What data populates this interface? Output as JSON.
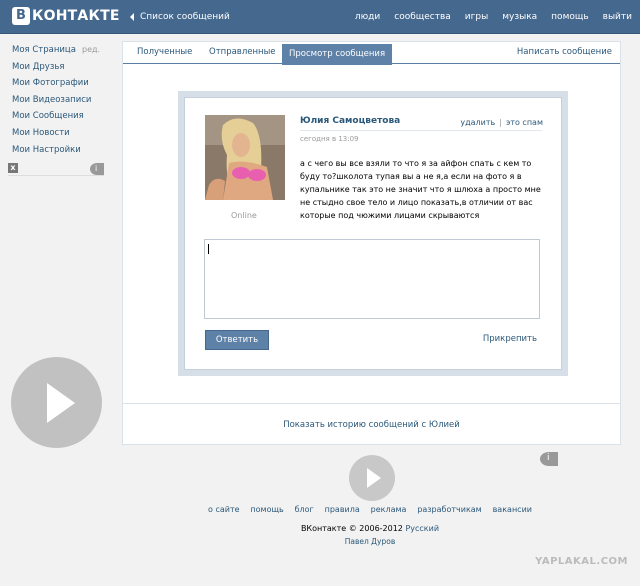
{
  "header": {
    "logo_letter": "В",
    "logo_text": "КОНТАКТЕ",
    "back_label": "Список сообщений",
    "nav": [
      "люди",
      "сообщества",
      "игры",
      "музыка",
      "помощь",
      "выйти"
    ]
  },
  "left_menu": {
    "items": [
      "Моя Страница",
      "Мои Друзья",
      "Мои Фотографии",
      "Мои Видеозаписи",
      "Мои Сообщения",
      "Мои Новости",
      "Мои Настройки"
    ],
    "edit_label": "ред."
  },
  "ad": {
    "close_glyph": "x"
  },
  "tabs": {
    "received": "Полученные",
    "sent": "Отправленные",
    "view": "Просмотр сообщения",
    "write": "Написать сообщение"
  },
  "message": {
    "sender": "Юлия Самоцветова",
    "date": "сегодня в 13:09",
    "delete_label": "удалить",
    "spam_label": "это спам",
    "online": "Online",
    "text": "а с чего вы все взяли то что я за айфон спать с кем то буду то?школота тупая вы а не я,а если на фото я в купальнике так это не значит что я шлюха а просто мне не стыдно свое тело и лицо показать,в отличии от вас которые под чюжими лицами скрываются"
  },
  "reply": {
    "button": "Ответить",
    "attach": "Прикрепить"
  },
  "history_link": "Показать историю сообщений с Юлией",
  "footer": {
    "links": [
      "о сайте",
      "помощь",
      "блог",
      "правила",
      "реклама",
      "разработчикам",
      "вакансии"
    ],
    "copyright": "ВКонтакте © 2006-2012",
    "language": "Русский",
    "author": "Павел Дуров"
  },
  "watermark": "YAPLAKAL.COM",
  "colors": {
    "header": "#45688e",
    "link": "#2b587a",
    "active_tab": "#5e81a8",
    "swimsuit": "#e85fb0"
  },
  "icons": [
    "back-arrow-icon",
    "play-icon",
    "info-icon",
    "close-icon"
  ]
}
